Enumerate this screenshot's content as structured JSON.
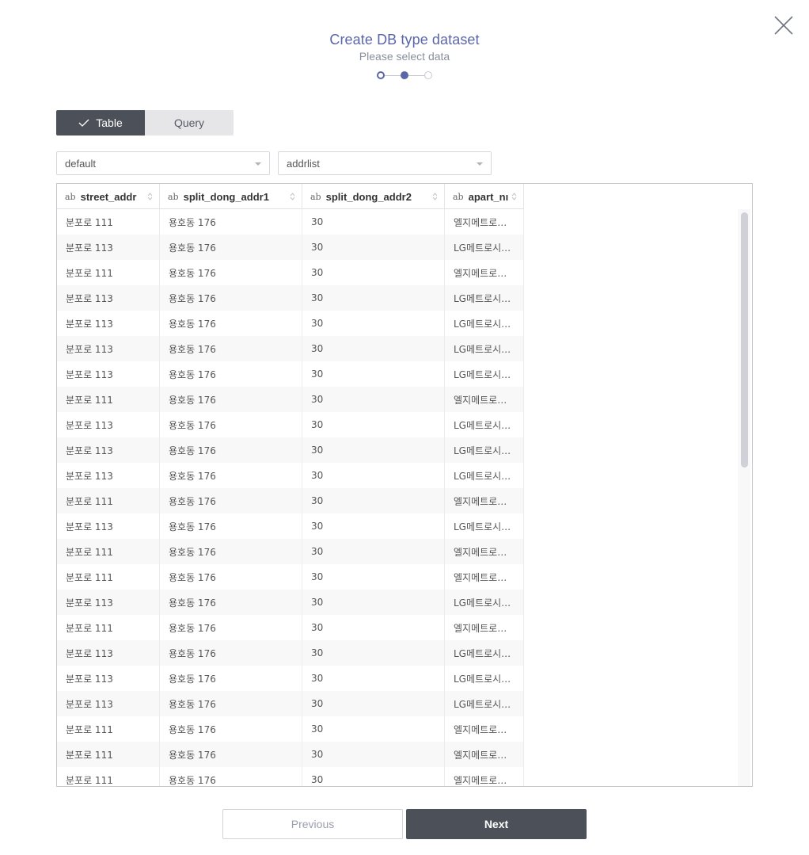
{
  "dialog": {
    "title": "Create DB type dataset",
    "subtitle": "Please select data",
    "close_icon": "close-icon",
    "steps": [
      {
        "index": 1,
        "state": "done"
      },
      {
        "index": 2,
        "state": "current"
      },
      {
        "index": 3,
        "state": "todo"
      }
    ],
    "accent_color": "#5b66a8"
  },
  "mode_toggle": {
    "options": [
      {
        "label": "Table",
        "selected": true,
        "icon": "check-icon"
      },
      {
        "label": "Query",
        "selected": false
      }
    ]
  },
  "selects": {
    "database": {
      "value": "default"
    },
    "table": {
      "value": "addrlist"
    }
  },
  "grid": {
    "columns": [
      {
        "type": "ab",
        "name": "street_addr"
      },
      {
        "type": "ab",
        "name": "split_dong_addr1"
      },
      {
        "type": "ab",
        "name": "split_dong_addr2"
      },
      {
        "type": "ab",
        "name": "apart_nı"
      }
    ],
    "rows": [
      [
        "분포로 111",
        "용호동 176",
        "30",
        "엘지메트로…"
      ],
      [
        "분포로 113",
        "용호동 176",
        "30",
        "LG메트로시…"
      ],
      [
        "분포로 111",
        "용호동 176",
        "30",
        "엘지메트로…"
      ],
      [
        "분포로 113",
        "용호동 176",
        "30",
        "LG메트로시…"
      ],
      [
        "분포로 113",
        "용호동 176",
        "30",
        "LG메트로시…"
      ],
      [
        "분포로 113",
        "용호동 176",
        "30",
        "LG메트로시…"
      ],
      [
        "분포로 113",
        "용호동 176",
        "30",
        "LG메트로시…"
      ],
      [
        "분포로 111",
        "용호동 176",
        "30",
        "엘지메트로…"
      ],
      [
        "분포로 113",
        "용호동 176",
        "30",
        "LG메트로시…"
      ],
      [
        "분포로 113",
        "용호동 176",
        "30",
        "LG메트로시…"
      ],
      [
        "분포로 113",
        "용호동 176",
        "30",
        "LG메트로시…"
      ],
      [
        "분포로 111",
        "용호동 176",
        "30",
        "엘지메트로…"
      ],
      [
        "분포로 113",
        "용호동 176",
        "30",
        "LG메트로시…"
      ],
      [
        "분포로 111",
        "용호동 176",
        "30",
        "엘지메트로…"
      ],
      [
        "분포로 111",
        "용호동 176",
        "30",
        "엘지메트로…"
      ],
      [
        "분포로 113",
        "용호동 176",
        "30",
        "LG메트로시…"
      ],
      [
        "분포로 111",
        "용호동 176",
        "30",
        "엘지메트로…"
      ],
      [
        "분포로 113",
        "용호동 176",
        "30",
        "LG메트로시…"
      ],
      [
        "분포로 113",
        "용호동 176",
        "30",
        "LG메트로시…"
      ],
      [
        "분포로 113",
        "용호동 176",
        "30",
        "LG메트로시…"
      ],
      [
        "분포로 111",
        "용호동 176",
        "30",
        "엘지메트로…"
      ],
      [
        "분포로 111",
        "용호동 176",
        "30",
        "엘지메트로…"
      ],
      [
        "분포로 111",
        "용호동 176",
        "30",
        "엘지메트로…"
      ]
    ]
  },
  "footer": {
    "previous_label": "Previous",
    "next_label": "Next"
  }
}
